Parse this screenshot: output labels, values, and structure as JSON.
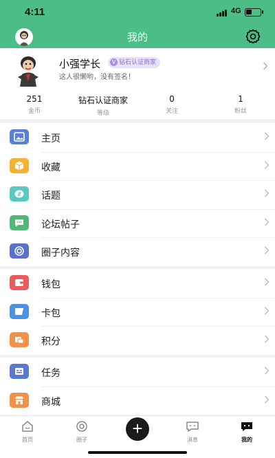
{
  "status": {
    "time": "4:11",
    "network": "4G"
  },
  "header": {
    "title": "我的"
  },
  "profile": {
    "name": "小强学长",
    "badge_icon": "V",
    "badge": "钻石认证商家",
    "signature": "这人很懒哟，没有签名！",
    "stats": [
      {
        "value": "251",
        "label": "金币"
      },
      {
        "value": "钻石认证商家",
        "label": "等级"
      },
      {
        "value": "0",
        "label": "关注"
      },
      {
        "value": "1",
        "label": "粉丝"
      }
    ]
  },
  "menu": {
    "group1": [
      {
        "label": "主页",
        "icon": "image-icon",
        "color": "#5b7fd1"
      },
      {
        "label": "收藏",
        "icon": "box-icon",
        "color": "#f3b234"
      },
      {
        "label": "话题",
        "icon": "topic-icon",
        "color": "#58c9c0"
      },
      {
        "label": "论坛帖子",
        "icon": "chat-icon",
        "color": "#54b776"
      },
      {
        "label": "圈子内容",
        "icon": "circle-icon",
        "color": "#5a71cc"
      }
    ],
    "group2": [
      {
        "label": "钱包",
        "icon": "wallet-icon",
        "color": "#ec5b5b"
      },
      {
        "label": "卡包",
        "icon": "card-icon",
        "color": "#4e92e3"
      },
      {
        "label": "积分",
        "icon": "points-icon",
        "color": "#f2924a"
      }
    ],
    "group3": [
      {
        "label": "任务",
        "icon": "task-icon",
        "color": "#5a7ad1"
      },
      {
        "label": "商城",
        "icon": "shop-icon",
        "color": "#f2924a"
      }
    ]
  },
  "tabbar": {
    "tabs": [
      {
        "label": "首页",
        "icon": "home-icon"
      },
      {
        "label": "圈子",
        "icon": "circle-tab-icon"
      },
      {
        "label": "消息",
        "icon": "message-icon"
      },
      {
        "label": "我的",
        "icon": "profile-icon"
      }
    ],
    "plus_symbol": "+"
  },
  "colors": {
    "brand": "#4cbd86",
    "badge": "#8c6fce"
  }
}
